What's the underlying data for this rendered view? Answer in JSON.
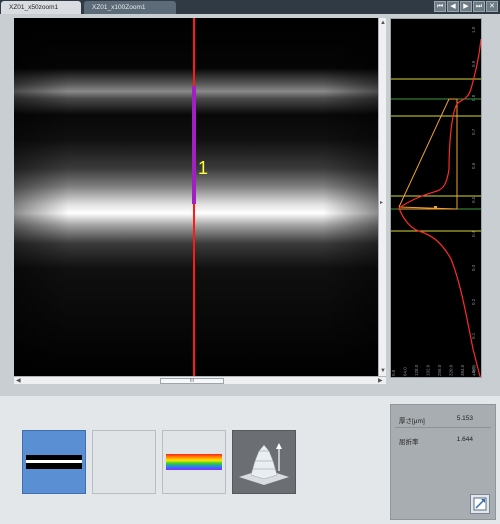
{
  "tabs": [
    {
      "label": "XZ01_x50zoom1",
      "active": true
    },
    {
      "label": "XZ01_x100Zoom1",
      "active": false
    }
  ],
  "image_view": {
    "marker_label": "1",
    "scroll_thumb": "III",
    "line_color": "#ff1a1a",
    "marker_color": "#ffff33"
  },
  "profile_axis": {
    "left_ticks": [
      "1.0",
      "0.9",
      "0.8",
      "0.7",
      "0.6",
      "0.5",
      "0.4",
      "0.3",
      "0.2",
      "0.1",
      "0.0"
    ],
    "bottom_ticks": [
      "0.0",
      "64.0",
      "128.0",
      "192.0",
      "256.0",
      "320.0",
      "384.0",
      "448.0"
    ]
  },
  "tools": [
    {
      "name": "layer-view-tool",
      "icon": "layer-stripes-icon",
      "selected": true
    },
    {
      "name": "blank-tool",
      "icon": "blank-icon",
      "selected": false
    },
    {
      "name": "spectrum-tool",
      "icon": "rainbow-gradient-icon",
      "selected": false
    },
    {
      "name": "3d-view-tool",
      "icon": "3d-surface-icon",
      "selected": false
    }
  ],
  "measurements": [
    {
      "label": "厚さ[μm]",
      "value": "5.153"
    },
    {
      "label": "屈折率",
      "value": "1.644"
    }
  ],
  "colors": {
    "tabbar": "#2f3a45",
    "selected_tool": "#5b8fd3",
    "profile_curve": "#ff2a2a",
    "guide_yellow": "#d8d83a",
    "guide_green": "#3c9a3c",
    "guide_orange": "#f0a030"
  }
}
